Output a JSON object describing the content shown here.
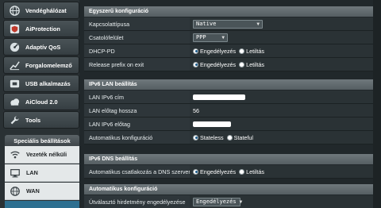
{
  "sidebar": {
    "items": [
      {
        "label": "Vendéghálózat",
        "icon": "globe-icon"
      },
      {
        "label": "AiProtection",
        "icon": "shield-icon"
      },
      {
        "label": "Adaptív QoS",
        "icon": "qos-icon"
      },
      {
        "label": "Forgalomelemző",
        "icon": "analyzer-icon"
      },
      {
        "label": "USB alkalmazás",
        "icon": "usb-icon"
      },
      {
        "label": "AiCloud 2.0",
        "icon": "cloud-icon"
      },
      {
        "label": "Tools",
        "icon": "wrench-icon"
      }
    ],
    "advanced_title": "Speciális beállítások",
    "advanced_items": [
      {
        "label": "Vezeték nélküli",
        "icon": "wifi-icon"
      },
      {
        "label": "LAN",
        "icon": "lan-icon"
      },
      {
        "label": "WAN",
        "icon": "wan-icon"
      }
    ]
  },
  "sections": {
    "basic": {
      "title": "Egyszerű konfiguráció",
      "connection_type_label": "Kapcsolattípusa",
      "connection_type_value": "Native",
      "interface_label": "Csatolófelület",
      "interface_value": "PPP",
      "dhcp_pd_label": "DHCP-PD",
      "release_prefix_label": "Release prefix on exit",
      "enable_label": "Engedélyezés",
      "disable_label": "Letiltás"
    },
    "lan": {
      "title": "IPv6 LAN beállítás",
      "lan_ipv6_addr_label": "LAN IPv6 cím",
      "prefix_length_label": "LAN előtag hossza",
      "prefix_length_value": "56",
      "lan_prefix_label": "LAN IPv6 előtag",
      "auto_config_label": "Automatikus konfiguráció",
      "stateless_label": "Stateless",
      "stateful_label": "Stateful"
    },
    "dns": {
      "title": "IPv6 DNS beállítás",
      "auto_dns_label": "Automatikus csatlakozás a DNS szerverhez",
      "enable_label": "Engedélyezés",
      "disable_label": "Letiltás"
    },
    "auto": {
      "title": "Automatikus konfiguráció",
      "router_adv_label": "Útválasztó hirdetmény engedélyezése",
      "router_adv_value": "Engedélyezés"
    }
  }
}
